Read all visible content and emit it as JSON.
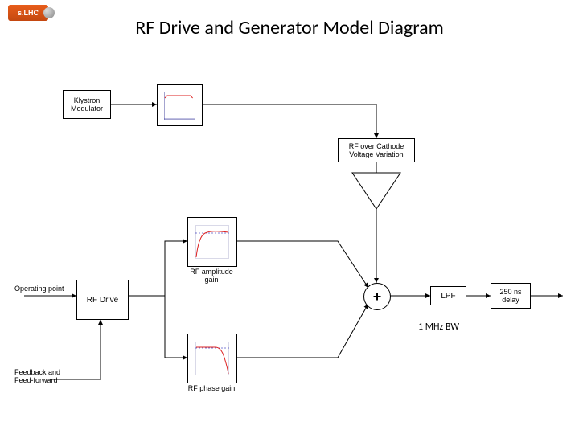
{
  "logo": {
    "text": "s.LHC"
  },
  "title": "RF Drive and Generator Model Diagram",
  "blocks": {
    "klystron": "Klystron\nModulator",
    "rf_cathode": "RF over Cathode\nVoltage Variation",
    "rf_drive": "RF Drive",
    "lpf": "LPF",
    "delay": "250 ns\ndelay"
  },
  "labels": {
    "operating_point": "Operating point",
    "feedback": "Feedback and\nFeed-forward",
    "rf_amp_gain": "RF amplitude\ngain",
    "rf_phase_gain": "RF phase gain"
  },
  "summer": "+",
  "annotation": "1 MHz BW"
}
